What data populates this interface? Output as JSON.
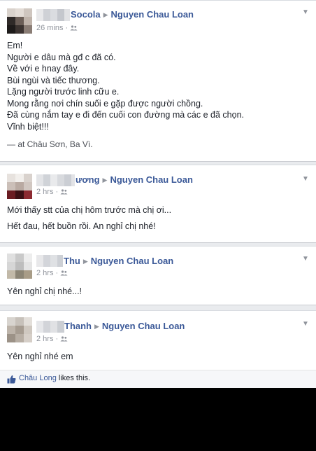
{
  "posts": [
    {
      "author": "Socola",
      "target": "Nguyen Chau Loan",
      "time": "26 mins",
      "body": "Em!\nNgười e dâu mà gđ c đã có.\nVề với e hnay đây.\nBùi ngùi và tiếc thương.\nLặng người trước linh cữu e.\nMong rằng nơi chín suối e gặp được người chồng.\nĐã cùng nắm tay e đi đến cuối con đường mà các e đã chọn.\nVĩnh biệt!!!",
      "place": "— at Châu Sơn, Ba Vì."
    },
    {
      "author": "ương",
      "target": "Nguyen Chau Loan",
      "time": "2 hrs",
      "body_line1": "Mới thấy stt của chị hôm trước mà chị ơi...",
      "body_line2": "Hết đau, hết buồn rồi. An nghỉ chị nhé!"
    },
    {
      "author": "Thu",
      "target": "Nguyen Chau Loan",
      "time": "2 hrs",
      "body": "Yên nghỉ chị nhé...!"
    },
    {
      "author": "Thanh",
      "target": "Nguyen Chau Loan",
      "time": "2 hrs",
      "body": "Yên nghỉ nhé em"
    }
  ],
  "likes": {
    "who": "Châu Long",
    "tail": "likes this."
  },
  "icons": {
    "arrow": "right-arrow-icon",
    "audience": "friends-icon",
    "menu": "chevron-down-icon",
    "like": "like-thumb-icon"
  },
  "colors": {
    "link": "#3b5998",
    "muted": "#90949c",
    "text": "#1d2129"
  }
}
